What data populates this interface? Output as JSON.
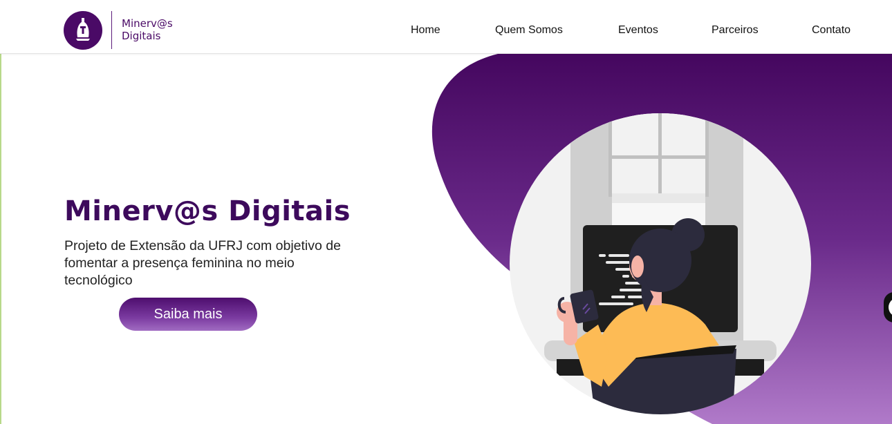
{
  "brand": {
    "line1": "Minerv@s",
    "line2": "Digitais",
    "logo_icon": "minerva-helmet-icon"
  },
  "nav": {
    "items": [
      "Home",
      "Quem Somos",
      "Eventos",
      "Parceiros",
      "Contato"
    ]
  },
  "hero": {
    "title": "Minerv@s Digitais",
    "description": "Projeto de Extensão da UFRJ com objetivo de fomentar a presença feminina no meio tecnológico",
    "cta_label": "Saiba mais"
  },
  "colors": {
    "brand_purple": "#4a0a66",
    "blob_top": "#45075f",
    "blob_bottom": "#b07ac9",
    "shirt": "#fdbb55"
  },
  "illustration": "woman-coding-at-computer-illustration",
  "floating_widget_icon": "chat-widget-icon"
}
